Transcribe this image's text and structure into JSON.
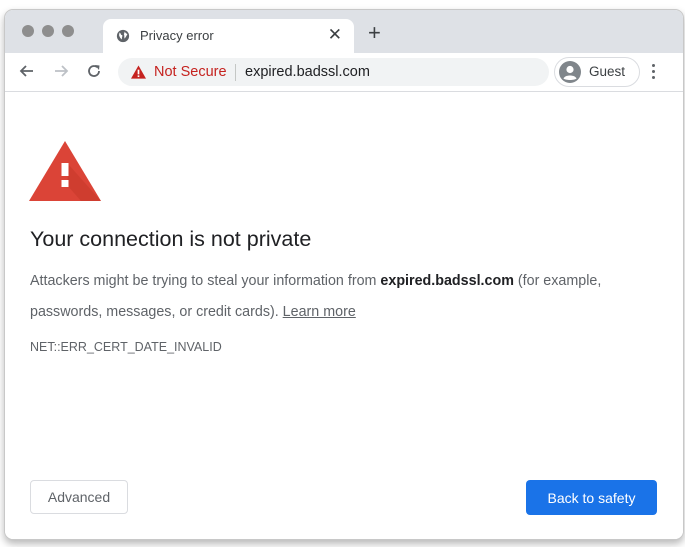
{
  "browser": {
    "tab": {
      "title": "Privacy error",
      "favicon": "globe-icon",
      "close_glyph": "✕"
    },
    "new_tab_glyph": "+",
    "nav": {
      "back": "arrow-left-icon",
      "forward": "arrow-right-icon",
      "reload": "reload-icon"
    },
    "omnibox": {
      "security_label": "Not Secure",
      "security_icon": "warning-triangle-icon",
      "url": "expired.badssl.com"
    },
    "profile": {
      "label": "Guest",
      "icon": "avatar-icon"
    },
    "menu_icon": "kebab-menu-icon"
  },
  "page": {
    "heading": "Your connection is not private",
    "desc_prefix": "Attackers might be trying to steal your information from ",
    "desc_domain": "expired.badssl.com",
    "desc_suffix": " (for example, passwords, messages, or credit cards). ",
    "learn_more": "Learn more",
    "error_code": "NET::ERR_CERT_DATE_INVALID",
    "advanced_button": "Advanced",
    "back_button": "Back to safety"
  },
  "colors": {
    "warning_red": "#db4437",
    "not_secure_red": "#c5221f",
    "primary_blue": "#1a73e8",
    "tabstrip_gray": "#dee1e6"
  }
}
